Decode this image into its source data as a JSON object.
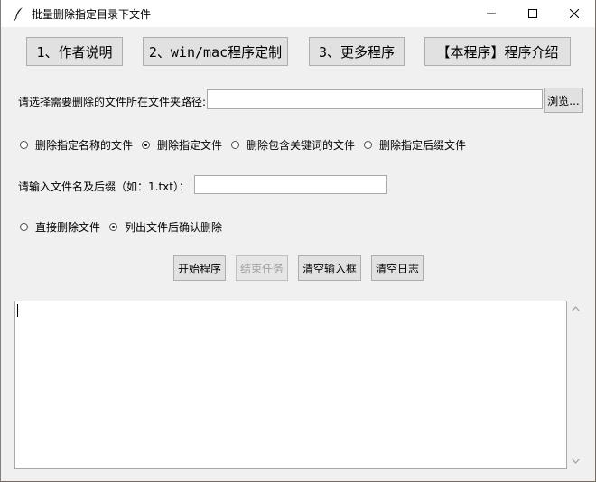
{
  "window": {
    "title": "批量删除指定目录下文件"
  },
  "top_buttons": [
    "1、作者说明",
    "2、win/mac程序定制",
    "3、更多程序",
    "【本程序】程序介绍"
  ],
  "folder": {
    "label": "请选择需要删除的文件所在文件夹路径:",
    "value": "",
    "browse_label": "浏览..."
  },
  "mode_options": [
    {
      "label": "删除指定名称的文件",
      "checked": false
    },
    {
      "label": "删除指定文件",
      "checked": true
    },
    {
      "label": "删除包含关键词的文件",
      "checked": false
    },
    {
      "label": "删除指定后缀文件",
      "checked": false
    }
  ],
  "filename": {
    "label": "请输入文件名及后缀（如：1.txt）：",
    "value": ""
  },
  "delete_options": [
    {
      "label": "直接删除文件",
      "checked": false
    },
    {
      "label": "列出文件后确认删除",
      "checked": true
    }
  ],
  "actions": {
    "start": "开始程序",
    "stop": "结束任务",
    "clear_input": "清空输入框",
    "clear_log": "清空日志"
  },
  "log": {
    "content": ""
  }
}
